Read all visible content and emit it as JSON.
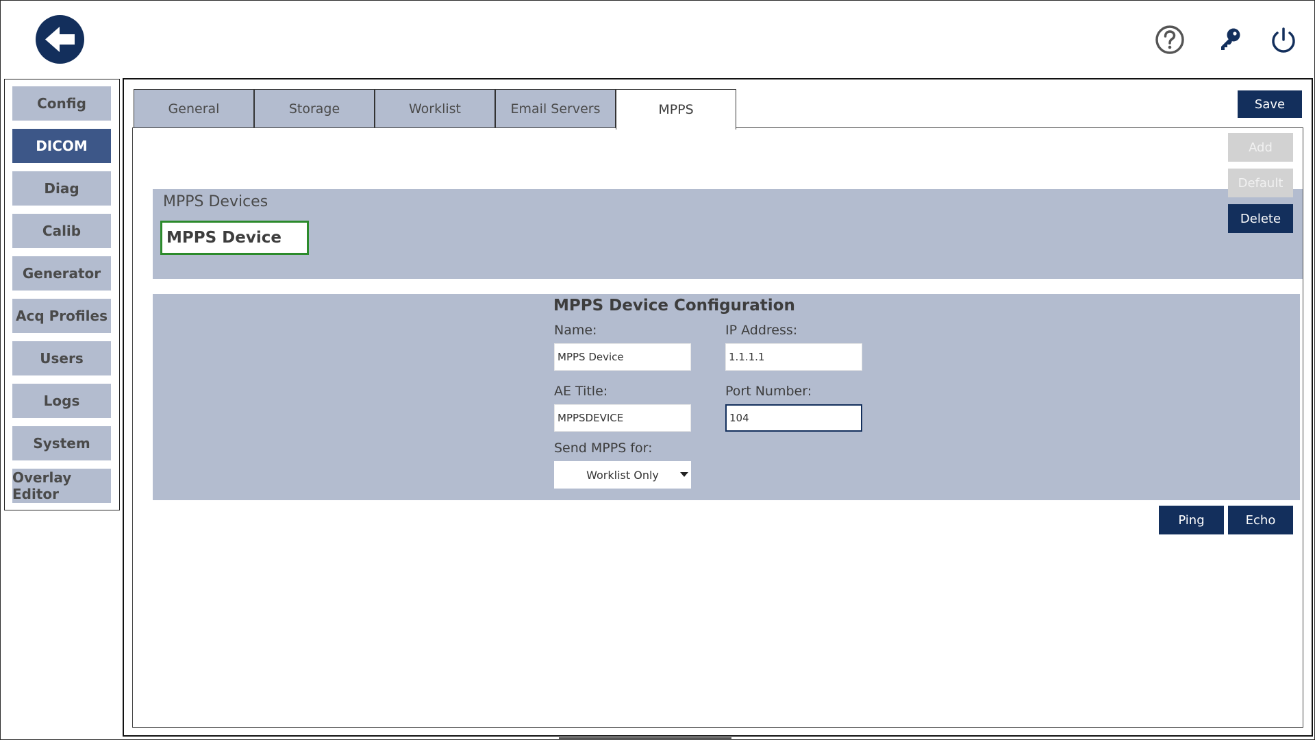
{
  "header": {
    "back_icon": "arrow-left-icon",
    "help_icon": "help-circle-icon",
    "key_icon": "key-icon",
    "power_icon": "power-icon"
  },
  "sidebar": {
    "items": [
      {
        "label": "Config"
      },
      {
        "label": "DICOM"
      },
      {
        "label": "Diag"
      },
      {
        "label": "Calib"
      },
      {
        "label": "Generator"
      },
      {
        "label": "Acq Profiles"
      },
      {
        "label": "Users"
      },
      {
        "label": "Logs"
      },
      {
        "label": "System"
      },
      {
        "label": "Overlay Editor"
      }
    ],
    "active": "DICOM"
  },
  "tabs": [
    {
      "label": "General"
    },
    {
      "label": "Storage"
    },
    {
      "label": "Worklist"
    },
    {
      "label": "Email Servers"
    },
    {
      "label": "MPPS"
    }
  ],
  "active_tab": "MPPS",
  "toolbar": {
    "save_label": "Save"
  },
  "devices": {
    "title": "MPPS Devices",
    "items": [
      {
        "label": "MPPS Device"
      }
    ],
    "add_label": "Add",
    "default_label": "Default",
    "delete_label": "Delete"
  },
  "config": {
    "title": "MPPS Device Configuration",
    "name_label": "Name:",
    "name_value": "MPPS Device",
    "ip_label": "IP Address:",
    "ip_value": "1.1.1.1",
    "ae_label": "AE Title:",
    "ae_value": "MPPSDEVICE",
    "port_label": "Port Number:",
    "port_value": "104",
    "send_label": "Send MPPS for:",
    "send_value": "Worklist Only"
  },
  "actions": {
    "ping_label": "Ping",
    "echo_label": "Echo"
  },
  "colors": {
    "navy": "#132f5c",
    "panel": "#b3bccf",
    "active_sidebar": "#3d5788",
    "selected_border": "#2b8a2b"
  }
}
